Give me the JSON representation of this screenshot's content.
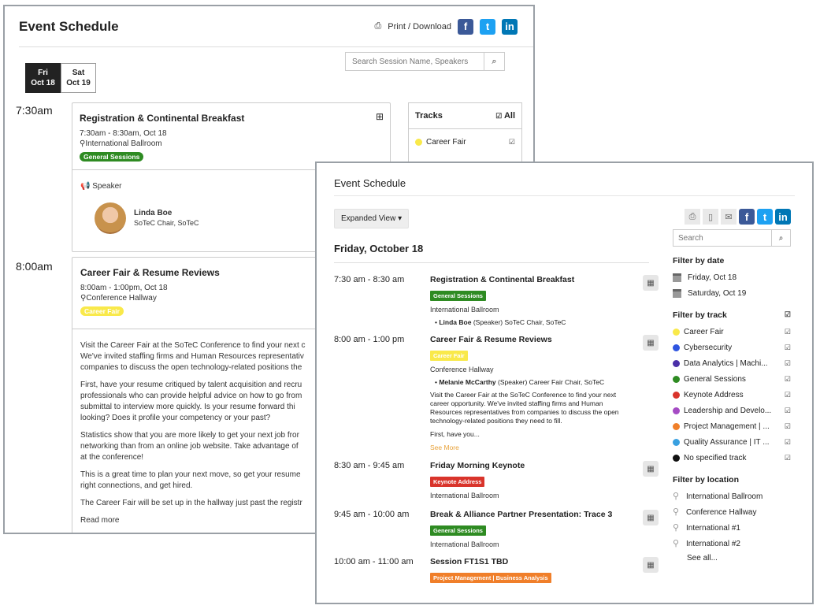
{
  "back": {
    "title": "Event Schedule",
    "print_label": "Print / Download",
    "date_tabs": [
      {
        "day": "Fri",
        "date": "Oct 18"
      },
      {
        "day": "Sat",
        "date": "Oct 19"
      }
    ],
    "search_placeholder": "Search Session Name, Speakers",
    "slots": [
      "7:30am",
      "8:00am"
    ],
    "card1": {
      "title": "Registration & Continental Breakfast",
      "time": "7:30am - 8:30am, Oct 18",
      "location": "International Ballroom",
      "badge": "General Sessions",
      "speaker_heading": "Speaker",
      "speaker_name": "Linda Boe",
      "speaker_role": "SoTeC Chair, SoTeC"
    },
    "card2": {
      "title": "Career Fair & Resume Reviews",
      "time": "8:00am - 1:00pm, Oct 18",
      "location": "Conference Hallway",
      "badge": "Career Fair",
      "paragraphs": [
        "Visit the Career Fair at the SoTeC Conference to find your next c",
        "We've invited staffing firms and Human Resources representativ",
        "companies to discuss the open technology-related positions the",
        "First, have your resume critiqued by talent acquisition and recru",
        "professionals who can provide helpful advice on how to go from",
        "submittal to interview more quickly. Is your resume forward thi",
        "looking? Does it profile your competency or your past?",
        "Statistics show that you are more likely to get your next job fror",
        "networking than from an online job website. Take advantage of",
        "at the conference!",
        "This is a great time to plan your next move, so get your resume",
        "right connections, and get hired.",
        "The Career Fair will be set up in the hallway just past the registr"
      ],
      "read_more": "Read more"
    },
    "tracks": {
      "heading": "Tracks",
      "all_label": "All",
      "first": "Career Fair"
    }
  },
  "front": {
    "title": "Event Schedule",
    "view_button": "Expanded View ▾",
    "day_heading": "Friday, October 18",
    "events": [
      {
        "time": "7:30 am - 8:30 am",
        "title": "Registration & Continental Breakfast",
        "tag": "General Sessions",
        "location": "International Ballroom",
        "speaker_name": "Linda Boe",
        "speaker_suffix": "(Speaker) SoTeC Chair, SoTeC"
      },
      {
        "time": "8:00 am - 1:00 pm",
        "title": "Career Fair & Resume Reviews",
        "tag": "Career Fair",
        "location": "Conference Hallway",
        "speaker_name": "Melanie McCarthy",
        "speaker_suffix": "(Speaker) Career Fair Chair, SoTeC",
        "desc": "Visit the Career Fair at the SoTeC Conference to find your next career opportunity. We've invited staffing firms and Human Resources representatives from companies to discuss the open technology-related positions they need to fill.",
        "desc2": "First, have you...",
        "more": "See More"
      },
      {
        "time": "8:30 am - 9:45 am",
        "title": "Friday Morning Keynote",
        "tag": "Keynote Address",
        "location": "International Ballroom"
      },
      {
        "time": "9:45 am - 10:00 am",
        "title": "Break & Alliance Partner Presentation: Trace 3",
        "tag": "General Sessions",
        "location": "International Ballroom"
      },
      {
        "time": "10:00 am - 11:00 am",
        "title": "Session FT1S1 TBD",
        "tag": "Project Management | Business Analysis"
      }
    ],
    "search_placeholder": "Search",
    "filter_date_heading": "Filter by date",
    "dates": [
      "Friday, Oct 18",
      "Saturday, Oct 19"
    ],
    "filter_track_heading": "Filter by track",
    "tracks": [
      {
        "name": "Career Fair",
        "color": "#f9e94a"
      },
      {
        "name": "Cybersecurity",
        "color": "#2f55e0"
      },
      {
        "name": "Data Analytics | Machi...",
        "color": "#4a2fa8"
      },
      {
        "name": "General Sessions",
        "color": "#2e8b22"
      },
      {
        "name": "Keynote Address",
        "color": "#d9342b"
      },
      {
        "name": "Leadership and Develo...",
        "color": "#a54bc4"
      },
      {
        "name": "Project Management | ...",
        "color": "#f07f2a"
      },
      {
        "name": "Quality Assurance | IT ...",
        "color": "#39a0e0"
      },
      {
        "name": "No specified track",
        "color": "#111111"
      }
    ],
    "filter_location_heading": "Filter by location",
    "locations": [
      "International Ballroom",
      "Conference Hallway",
      "International #1",
      "International #2"
    ],
    "see_all": "See all..."
  }
}
